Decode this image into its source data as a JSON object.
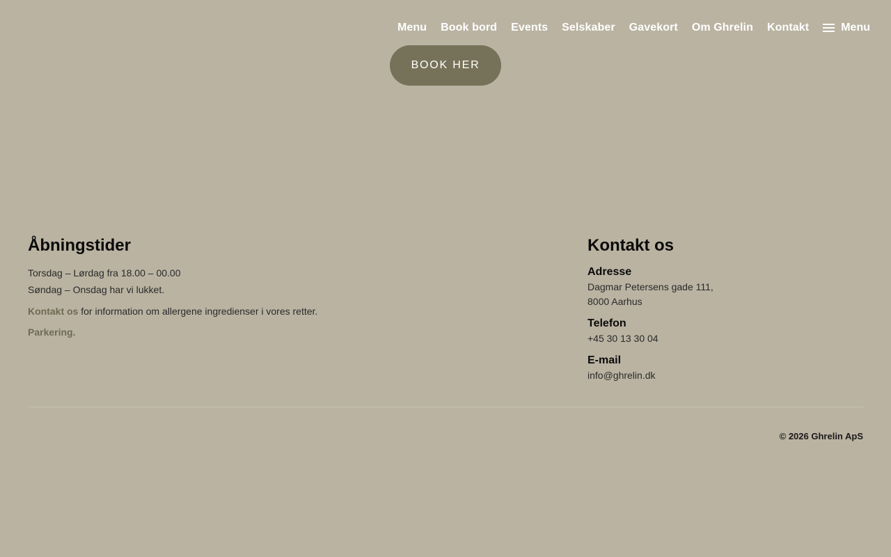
{
  "nav": {
    "items": [
      {
        "label": "Menu"
      },
      {
        "label": "Book bord"
      },
      {
        "label": "Events"
      },
      {
        "label": "Selskaber"
      },
      {
        "label": "Gavekort"
      },
      {
        "label": "Om Ghrelin"
      },
      {
        "label": "Kontakt"
      }
    ],
    "toggle_label": "Menu",
    "toggle_icon": "hamburger-menu-icon"
  },
  "hero": {
    "book_label": "BOOK HER",
    "book_color": "#767259"
  },
  "hours": {
    "title": "Åbningstider",
    "lines": [
      "Torsdag – Lørdag fra 18.00 – 00.00",
      "Søndag – Onsdag har vi lukket."
    ],
    "contact_link": "Kontakt os",
    "contact_rest": " for information om allergene ingredienser i vores retter.",
    "parking_link": "Parkering."
  },
  "contact": {
    "title": "Kontakt os",
    "address_label": "Adresse",
    "address_line1": "Dagmar Petersens gade 111,",
    "address_line2": "8000 Aarhus",
    "phone_label": "Telefon",
    "phone": "+45 30 13 30 04",
    "email_label": "E-mail",
    "email": "info@ghrelin.dk"
  },
  "footer": {
    "copyright": "© 2026 Ghrelin ApS"
  },
  "colors": {
    "background": "#bab3a2",
    "accent": "#6e6a52"
  }
}
